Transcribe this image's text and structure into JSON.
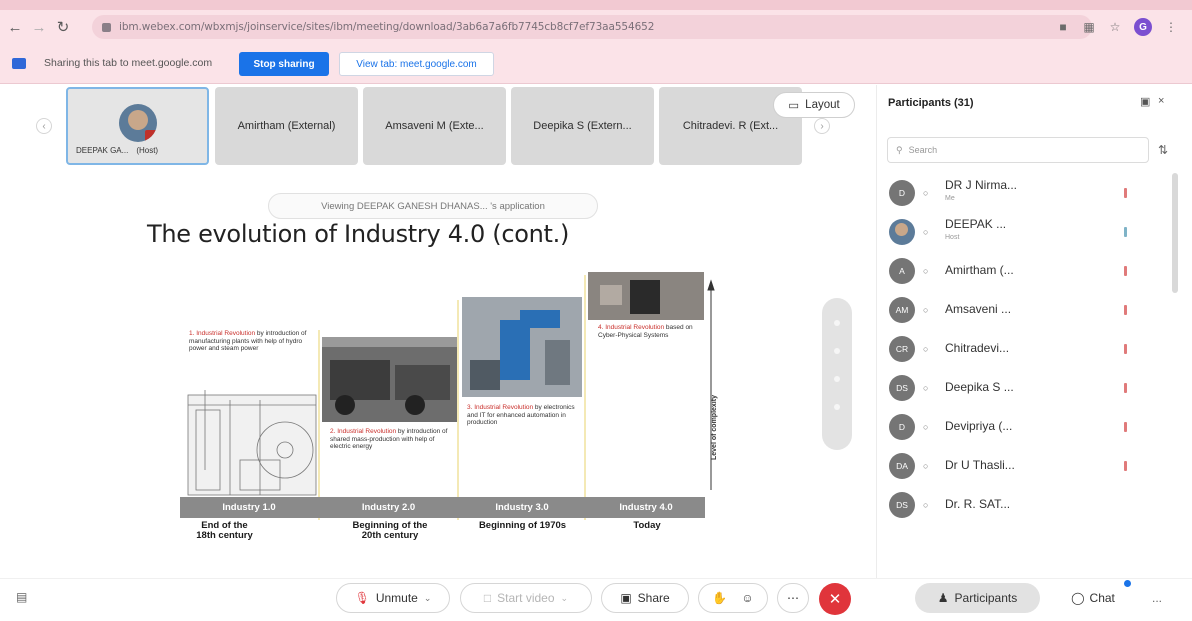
{
  "browser": {
    "url": "ibm.webex.com/wbxmjs/joinservice/sites/ibm/meeting/download/3ab6a7a6fb7745cb8cf7ef73aa554652",
    "profile_initial": "G",
    "icons": [
      "back-icon",
      "forward-icon",
      "reload-icon",
      "lock-icon",
      "extension-icon",
      "screen-icon",
      "star-icon",
      "menu-icon"
    ]
  },
  "sharing": {
    "text": "Sharing this tab to meet.google.com",
    "stop_label": "Stop sharing",
    "view_tab_label": "View tab: meet.google.com"
  },
  "thumbnails": [
    {
      "name": "DEEPAK GA...",
      "host": "(Host)"
    },
    {
      "name": "Amirtham (External)"
    },
    {
      "name": "Amsaveni M (Exte..."
    },
    {
      "name": "Deepika S (Extern..."
    },
    {
      "name": "Chitradevi. R (Ext..."
    }
  ],
  "layout_label": "Layout",
  "viewing_label": "Viewing DEEPAK GANESH DHANAS... 's application",
  "slide": {
    "title": "The evolution of Industry 4.0 (cont.)",
    "axis_label": "Level of complexity",
    "captions": [
      {
        "head": "1. Industrial Revolution",
        "body": " by introduction of manufacturing plants with help of hydro power and steam power"
      },
      {
        "head": "2. Industrial Revolution",
        "body": " by introduction of shared mass-production with help of electric energy"
      },
      {
        "head": "3. Industrial Revolution",
        "body": " by electronics and IT for enhanced automation in production"
      },
      {
        "head": "4. Industrial Revolution",
        "body": " based on Cyber-Physical Systems"
      }
    ],
    "stages": [
      "Industry 1.0",
      "Industry 2.0",
      "Industry 3.0",
      "Industry 4.0"
    ],
    "stage_labels": [
      [
        "End of the",
        "18th century"
      ],
      [
        "Beginning of the",
        "20th century"
      ],
      [
        "Beginning of 1970s",
        ""
      ],
      [
        "Today",
        ""
      ]
    ]
  },
  "panel": {
    "title": "Participants (31)",
    "search_placeholder": "Search",
    "participants": [
      {
        "initials": "D",
        "name": "DR J Nirma...",
        "sub": "Me",
        "mic": "muted"
      },
      {
        "initials": "",
        "name": "DEEPAK ...",
        "sub": "Host",
        "mic": "on"
      },
      {
        "initials": "A",
        "name": "Amirtham (...",
        "sub": "",
        "mic": "muted"
      },
      {
        "initials": "AM",
        "name": "Amsaveni ...",
        "sub": "",
        "mic": "muted"
      },
      {
        "initials": "CR",
        "name": "Chitradevi...",
        "sub": "",
        "mic": "muted"
      },
      {
        "initials": "DS",
        "name": "Deepika S ...",
        "sub": "",
        "mic": "muted"
      },
      {
        "initials": "D",
        "name": "Devipriya (...",
        "sub": "",
        "mic": "muted"
      },
      {
        "initials": "DA",
        "name": "Dr U Thasli...",
        "sub": "",
        "mic": "muted"
      },
      {
        "initials": "DS",
        "name": "Dr. R. SAT...",
        "sub": "",
        "mic": "none"
      }
    ]
  },
  "toolbar": {
    "unmute": "Unmute",
    "start_video": "Start video",
    "share": "Share",
    "participants": "Participants",
    "chat": "Chat",
    "more": "..."
  }
}
